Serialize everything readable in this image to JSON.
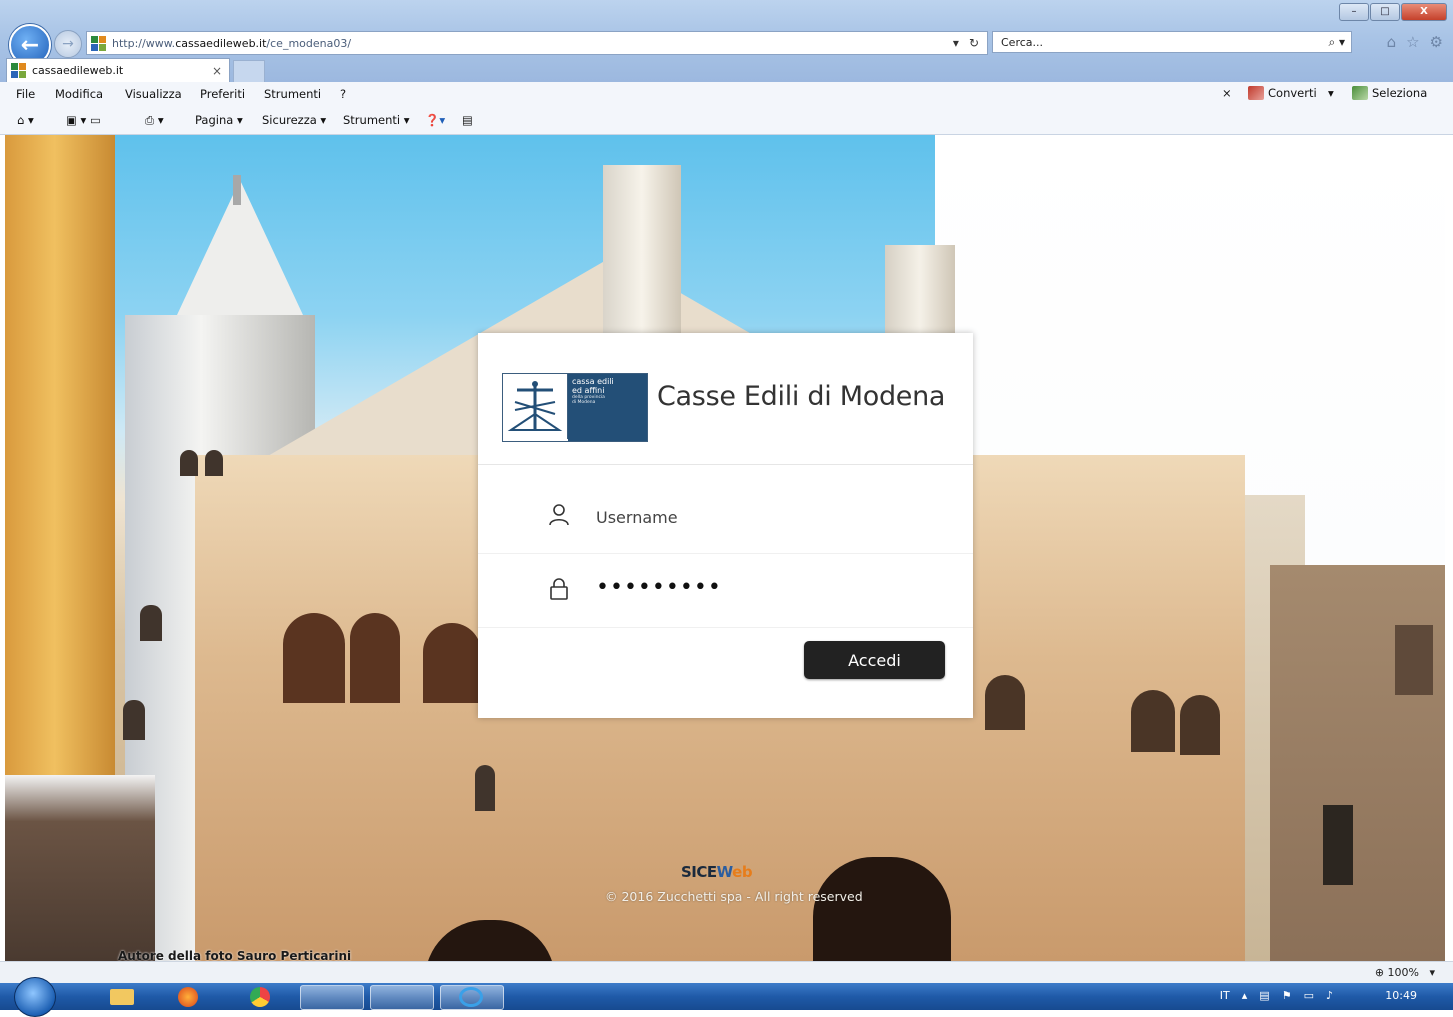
{
  "browser": {
    "address_prefix": "http://www.",
    "address_domain": "cassaedileweb.it",
    "address_path": "/ce_modena03/",
    "search_placeholder": "Cerca...",
    "tab_title": "cassaedileweb.it",
    "menu": [
      "File",
      "Modifica",
      "Visualizza",
      "Preferiti",
      "Strumenti",
      "?"
    ],
    "converti_label": "Converti",
    "seleziona_label": "Seleziona",
    "cmd": {
      "pagina": "Pagina ▾",
      "sicurezza": "Sicurezza ▾",
      "strumenti": "Strumenti ▾"
    }
  },
  "login": {
    "title": "Casse Edili di Modena",
    "logo_lines": [
      "cassa edili",
      "ed affini"
    ],
    "logo_sub": [
      "della provincia",
      "di Modena"
    ],
    "username_placeholder": "Username",
    "password_value": "•••••••••",
    "submit_label": "Accedi"
  },
  "footer": {
    "brand_sice": "SICE",
    "brand_w": "W",
    "brand_e": "e",
    "brand_b": "b",
    "copyright": "© 2016 Zucchetti spa - All right reserved",
    "photo_credit": "Autore della foto Sauro Perticarini"
  },
  "status": {
    "zoom": "100%"
  },
  "taskbar": {
    "lang": "IT",
    "time": "10:49"
  }
}
